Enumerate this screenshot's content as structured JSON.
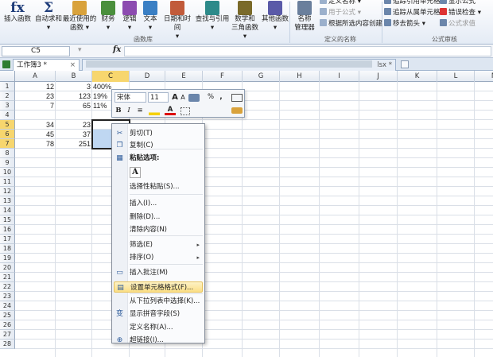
{
  "ribbon": {
    "buttons": [
      {
        "label1": "插入函数",
        "label2": "",
        "icon": "fx-icon",
        "color": "#1f3d7a"
      },
      {
        "label1": "自动求和",
        "label2": "▾",
        "icon": "sigma-icon",
        "color": "#1f3d7a"
      },
      {
        "label1": "最近使用的",
        "label2": "函数 ▾",
        "icon": "book-star-icon",
        "color": "#d9a23b"
      },
      {
        "label1": "财务",
        "label2": "▾",
        "icon": "book-finance-icon",
        "color": "#4a8f3c"
      },
      {
        "label1": "逻辑",
        "label2": "▾",
        "icon": "book-logic-icon",
        "color": "#8c4bb0"
      },
      {
        "label1": "文本",
        "label2": "▾",
        "icon": "book-text-icon",
        "color": "#3a7fc4"
      },
      {
        "label1": "日期和时间",
        "label2": "▾",
        "icon": "book-date-icon",
        "color": "#c15a3a"
      },
      {
        "label1": "查找与引用",
        "label2": "▾",
        "icon": "book-lookup-icon",
        "color": "#2d8a8a"
      },
      {
        "label1": "数学和",
        "label2": "三角函数 ▾",
        "icon": "book-math-icon",
        "color": "#7a6a2a"
      },
      {
        "label1": "其他函数",
        "label2": "▾",
        "icon": "book-more-icon",
        "color": "#5a5aa8"
      },
      {
        "label1": "名称",
        "label2": "管理器",
        "icon": "name-manager-icon",
        "color": "#6a7f9c"
      }
    ],
    "group_function_library": "函数库",
    "group_defined_names": "定义的名称",
    "group_formula_auditing": "公式审核",
    "names_items": [
      "定义名称 ▾",
      "用于公式 ▾",
      "根据所选内容创建"
    ],
    "audit_items": [
      "追踪引用单元格",
      "追踪从属单元格",
      "移去箭头 ▾",
      "显示公式",
      "错误检查 ▾",
      "公式求值"
    ]
  },
  "formula_bar": {
    "name_box": "C5",
    "fx": "fx",
    "value": ""
  },
  "tabs": {
    "active": "工作簿3 *",
    "close": "×",
    "second": "lsx *"
  },
  "columns": [
    "A",
    "B",
    "C",
    "D",
    "E",
    "F",
    "G",
    "H",
    "I",
    "J",
    "K",
    "L",
    "M"
  ],
  "rows": [
    "1",
    "2",
    "3",
    "4",
    "5",
    "6",
    "7",
    "8",
    "9",
    "10",
    "11",
    "12",
    "13",
    "14",
    "15",
    "16",
    "17",
    "18",
    "19",
    "20",
    "21",
    "22",
    "23",
    "24",
    "25",
    "26",
    "27",
    "28"
  ],
  "cells": {
    "A1": "12",
    "B1": "3",
    "C1": "400%",
    "A2": "23",
    "B2": "123",
    "C2": "19%",
    "A3": "7",
    "B3": "65",
    "C3": "11%",
    "A5": "34",
    "B5": "23",
    "A6": "45",
    "B6": "37",
    "A7": "78",
    "B7": "251"
  },
  "mini_toolbar": {
    "font": "宋体",
    "size": "11",
    "grow": "A",
    "shrink": "A",
    "percent": "%",
    "comma": ",",
    "bold": "B",
    "italic": "I",
    "align": "≡",
    "font_color": "A"
  },
  "context_menu": {
    "cut": "剪切(T)",
    "copy": "复制(C)",
    "paste_options": "粘贴选项:",
    "paste_icon": "A",
    "paste_special": "选择性粘贴(S)...",
    "insert": "插入(I)...",
    "delete": "删除(D)...",
    "clear": "清除内容(N)",
    "filter": "筛选(E)",
    "sort": "排序(O)",
    "insert_comment": "插入批注(M)",
    "format_cells": "设置单元格格式(F)...",
    "pick_list": "从下拉列表中选择(K)...",
    "phonetic": "显示拼音字段(S)",
    "define_name": "定义名称(A)...",
    "hyperlink": "超链接(I)...",
    "arrow": "▸"
  },
  "colors": {
    "accent": "#f7d66e",
    "selection": "#bfd7f2",
    "menu_hover": "#fbdf86"
  }
}
